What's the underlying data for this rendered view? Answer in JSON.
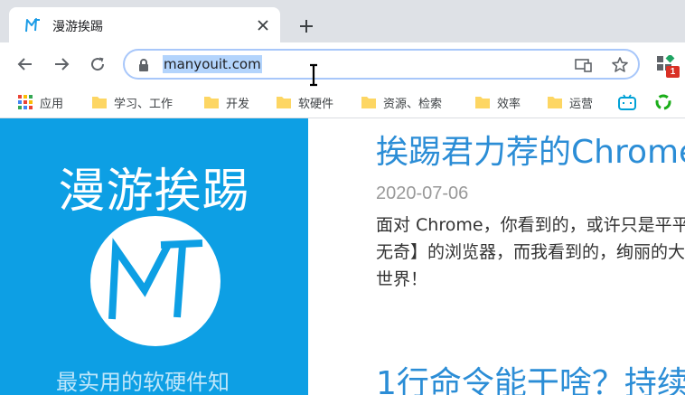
{
  "tab": {
    "title": "漫游挨踢"
  },
  "omnibox": {
    "url": "manyouit.com"
  },
  "extensions": {
    "badge": "1"
  },
  "bookmarks": [
    {
      "label": "应用",
      "icon": "apps-grid-icon"
    },
    {
      "label": "学习、工作",
      "icon": "folder-icon"
    },
    {
      "label": "开发",
      "icon": "folder-icon"
    },
    {
      "label": "软硬件",
      "icon": "folder-icon"
    },
    {
      "label": "资源、检索",
      "icon": "folder-icon"
    },
    {
      "label": "效率",
      "icon": "folder-icon"
    },
    {
      "label": "运营",
      "icon": "folder-icon"
    }
  ],
  "sidebar": {
    "site_title": "漫游挨踢",
    "subtitle": "最实用的软硬件知"
  },
  "posts": [
    {
      "title": "挨踢君力荐的Chrome",
      "date": "2020-07-06",
      "excerpt": "面对 Chrome，你看到的，或许只是平平无奇】的浏览器，而我看到的，绚丽的大世界！"
    },
    {
      "title": "1行命令能干啥？持续"
    }
  ],
  "colors": {
    "accent": "#0d9fe4",
    "link": "#2b8dd6",
    "selection": "#b3d4fc"
  }
}
